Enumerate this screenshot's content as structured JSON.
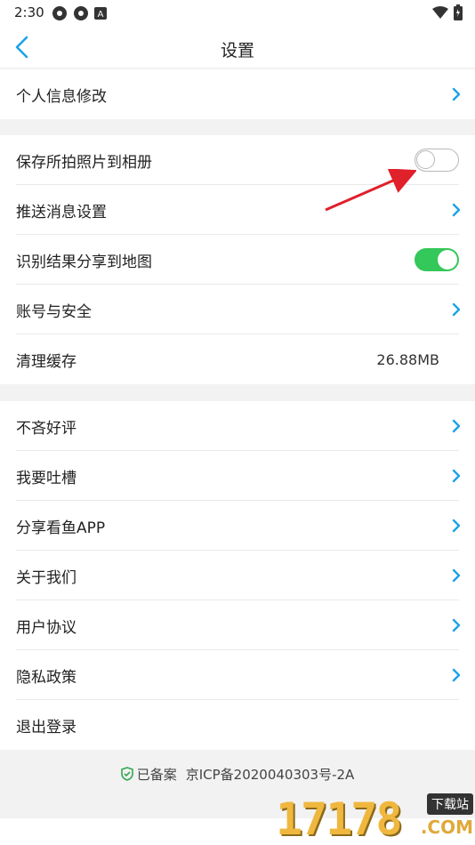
{
  "status_bar": {
    "time": "2:30",
    "icons": [
      "gear-like-icon",
      "gear-like-icon",
      "a-icon",
      "wifi-icon",
      "battery-icon"
    ]
  },
  "header": {
    "title": "设置",
    "back_icon": "chevron-left-icon"
  },
  "group1": [
    {
      "label": "个人信息修改",
      "type": "link"
    }
  ],
  "group2": [
    {
      "label": "保存所拍照片到相册",
      "type": "toggle",
      "on": false
    },
    {
      "label": "推送消息设置",
      "type": "link"
    },
    {
      "label": "识别结果分享到地图",
      "type": "toggle",
      "on": true
    },
    {
      "label": "账号与安全",
      "type": "link"
    },
    {
      "label": "清理缓存",
      "type": "value",
      "value": "26.88MB"
    }
  ],
  "group3": [
    {
      "label": "不吝好评",
      "type": "link"
    },
    {
      "label": "我要吐槽",
      "type": "link"
    },
    {
      "label": "分享看鱼APP",
      "type": "link"
    },
    {
      "label": "关于我们",
      "type": "link"
    },
    {
      "label": "用户协议",
      "type": "link"
    },
    {
      "label": "隐私政策",
      "type": "link"
    },
    {
      "label": "退出登录",
      "type": "action"
    }
  ],
  "footer": {
    "record_label": "已备案",
    "icp": "京ICP备2020040303号-2A"
  },
  "watermark": {
    "number": "17178",
    "tag": "下载站",
    "domain": ".COM"
  },
  "colors": {
    "accent": "#1aa3e8",
    "toggle_on": "#34c759",
    "arrow": "#e0202a"
  }
}
